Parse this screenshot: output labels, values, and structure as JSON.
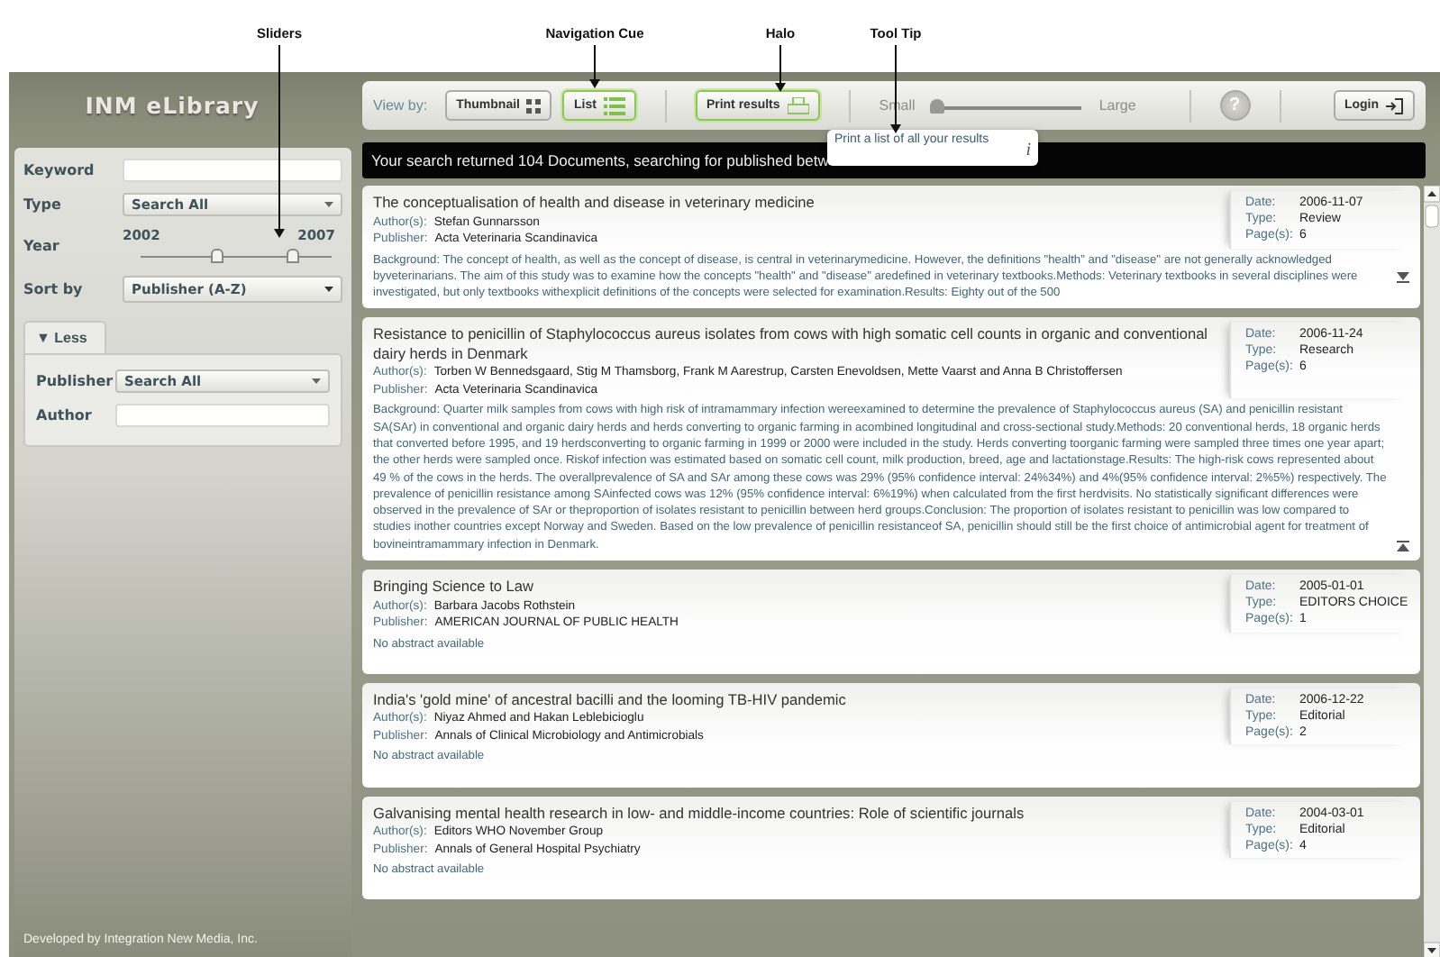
{
  "annotations": [
    {
      "label": "Sliders"
    },
    {
      "label": "Navigation Cue"
    },
    {
      "label": "Halo"
    },
    {
      "label": "Tool Tip"
    }
  ],
  "logo": "INM eLibrary",
  "footer": "Developed by Integration New Media, Inc.",
  "toolbar": {
    "view_by_label": "View by:",
    "view_buttons": [
      {
        "label": "Thumbnail",
        "kind": "grid",
        "selected": false
      },
      {
        "label": "List",
        "kind": "list",
        "selected": true
      }
    ],
    "print_button": {
      "label": "Print results",
      "halo": true
    },
    "size_slider": {
      "min_label": "Small",
      "max_label": "Large",
      "level": 0.03
    },
    "help": "?",
    "login": "Login"
  },
  "tooltip": {
    "text": "Print a list of all your results",
    "glyph": "i"
  },
  "search_form": {
    "keyword": {
      "label": "Keyword"
    },
    "type": {
      "label": "Type",
      "value": "Search All"
    },
    "year": {
      "label": "Year",
      "from": "2002",
      "to": "2007",
      "thumbs": [
        {
          "level": 0.4
        },
        {
          "level": 0.79
        }
      ]
    },
    "sort_by": {
      "label": "Sort by",
      "value": "Publisher (A-Z)"
    },
    "more_panel": {
      "toggle": "▼ Less",
      "expanded": true,
      "fields": [
        {
          "label": "Publisher",
          "kind": "select",
          "value": "Search All"
        },
        {
          "label": "Author",
          "kind": "text"
        }
      ]
    }
  },
  "banner": "Your search returned 104 Documents, searching for published betw",
  "results": [
    {
      "title": "The conceptualisation of health and disease in veterinary medicine",
      "authors_label": "Author(s):",
      "authors": "Stefan Gunnarsson",
      "publisher_label": "Publisher:",
      "publisher": "Acta Veterinaria Scandinavica",
      "abstract": "Background: The concept of health, as well as the concept of disease, is central in veterinarymedicine. However, the definitions \"health\" and \"disease\" are not generally acknowledged byveterinarians. The aim of this study was to examine how the concepts \"health\" and \"disease\" aredefined in veterinary textbooks.Methods: Veterinary textbooks in several disciplines were investigated, but only textbooks withexplicit definitions of the concepts were selected for examination.Results: Eighty out of the 500",
      "expanded": false,
      "meta": [
        {
          "label": "Date:",
          "value": "2006-11-07"
        },
        {
          "label": "Type:",
          "value": "Review"
        },
        {
          "label": "Page(s):",
          "value": "6"
        }
      ]
    },
    {
      "title": "Resistance to penicillin of Staphylococcus aureus isolates from cows with high somatic cell counts in organic and conventional dairy herds in Denmark",
      "authors_label": "Author(s):",
      "authors": "Torben W Bennedsgaard, Stig M Thamsborg, Frank M Aarestrup, Carsten Enevoldsen, Mette Vaarst and Anna B Christoffersen",
      "publisher_label": "Publisher:",
      "publisher": "Acta Veterinaria Scandinavica",
      "abstract": "Background: Quarter milk samples from cows with high risk of intramammary infection wereexamined to determine the prevalence of Staphylococcus aureus (SA) and penicillin resistant SA(SAr) in conventional and organic dairy herds and herds converting to organic farming in acombined longitudinal and cross-sectional study.Methods: 20 conventional herds, 18 organic herds that converted before 1995, and 19 herdsconverting to organic farming in 1999 or 2000 were included in the study. Herds converting toorganic farming were sampled three times one year apart; the other herds were sampled once. Riskof infection was estimated based on somatic cell count, milk production, breed, age and lactationstage.Results: The high-risk cows represented about 49 % of the cows in the herds. The overallprevalence of SA and SAr among these cows was 29% (95% confidence interval: 24%34%) and 4%(95% confidence interval: 2%5%) respectively. The prevalence of penicillin resistance among SAinfected cows was 12% (95% confidence interval: 6%19%) when calculated from the first herdvisits. No statistically significant differences were observed in the prevalence of SAr or theproportion of isolates resistant to penicillin between herd groups.Conclusion: The proportion of isolates resistant to penicillin was low compared to studies inother countries except Norway and Sweden. Based on the low prevalence of penicillin resistanceof SA, penicillin should still be the first choice of antimicrobial agent for treatment of bovineintramammary infection in Denmark.",
      "expanded": true,
      "meta": [
        {
          "label": "Date:",
          "value": "2006-11-24"
        },
        {
          "label": "Type:",
          "value": "Research"
        },
        {
          "label": "Page(s):",
          "value": "6"
        }
      ]
    },
    {
      "title": "Bringing Science to Law",
      "authors_label": "Author(s):",
      "authors": "Barbara Jacobs Rothstein",
      "publisher_label": "Publisher:",
      "publisher": "AMERICAN JOURNAL OF PUBLIC HEALTH",
      "abstract": "No abstract available",
      "meta": [
        {
          "label": "Date:",
          "value": "2005-01-01"
        },
        {
          "label": "Type:",
          "value": "EDITORS CHOICE"
        },
        {
          "label": "Page(s):",
          "value": "1"
        }
      ]
    },
    {
      "title": "India's 'gold mine' of ancestral bacilli and the looming TB-HIV pandemic",
      "authors_label": "Author(s):",
      "authors": "Niyaz Ahmed and Hakan Leblebicioglu",
      "publisher_label": "Publisher:",
      "publisher": "Annals of Clinical Microbiology and Antimicrobials",
      "abstract": "No abstract available",
      "meta": [
        {
          "label": "Date:",
          "value": "2006-12-22"
        },
        {
          "label": "Type:",
          "value": "Editorial"
        },
        {
          "label": "Page(s):",
          "value": "2"
        }
      ]
    },
    {
      "title": "Galvanising mental health research in low- and middle-income countries: Role of scientific journals",
      "authors_label": "Author(s):",
      "authors": "Editors WHO November  Group",
      "publisher_label": "Publisher:",
      "publisher": "Annals of General Hospital Psychiatry",
      "abstract": "No abstract available",
      "meta": [
        {
          "label": "Date:",
          "value": "2004-03-01"
        },
        {
          "label": "Type:",
          "value": "Editorial"
        },
        {
          "label": "Page(s):",
          "value": "4"
        }
      ]
    }
  ]
}
